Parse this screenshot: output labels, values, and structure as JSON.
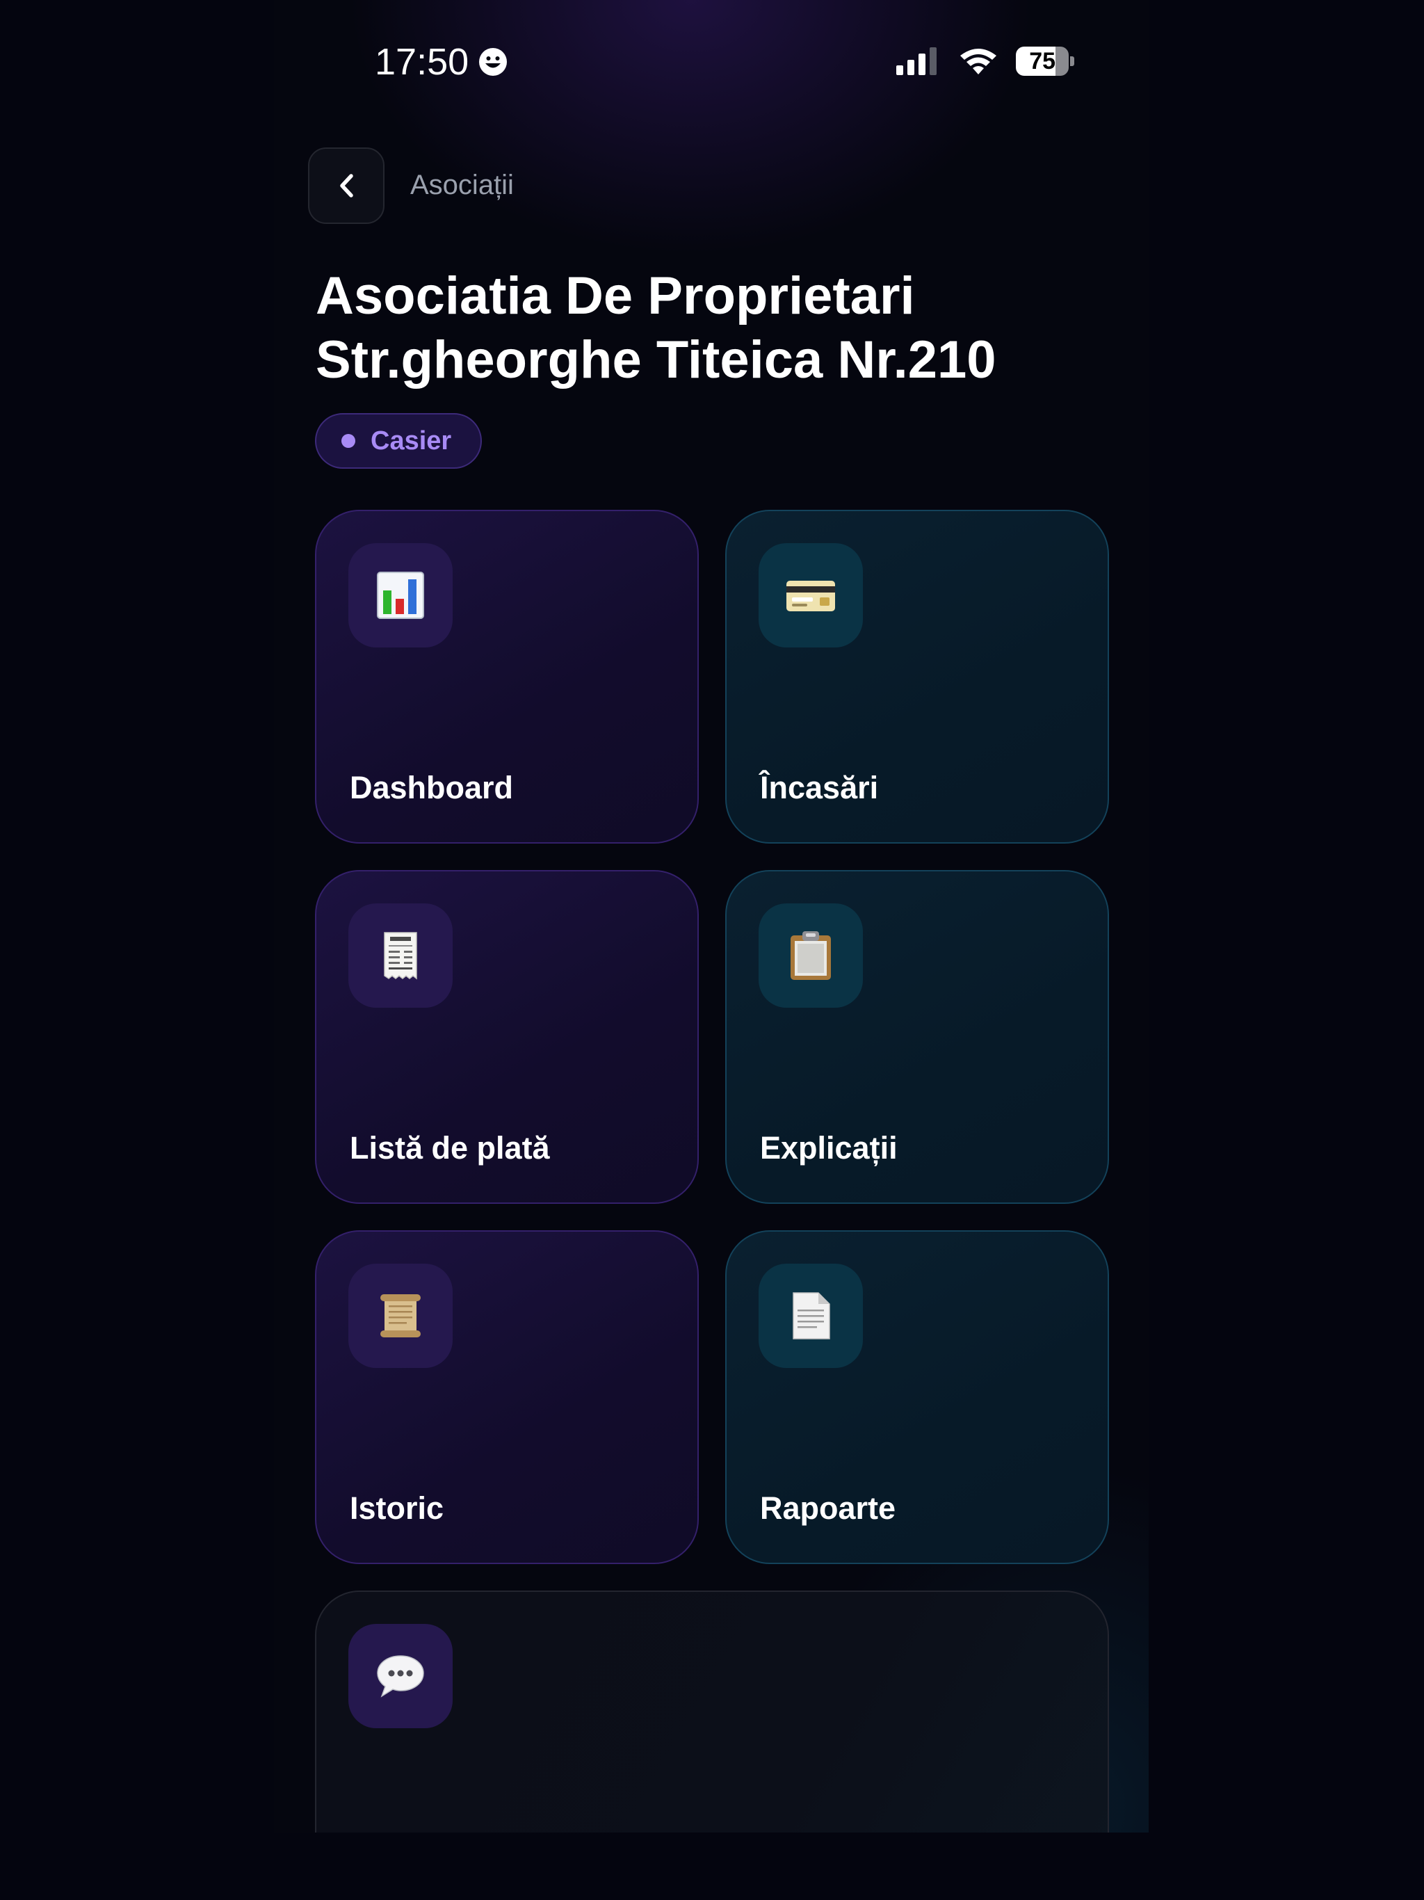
{
  "status_bar": {
    "time": "17:50",
    "battery": "75"
  },
  "header": {
    "back_icon": "chevron-left-icon",
    "breadcrumb": "Asociații",
    "title_line1": "Asociatia De Proprietari",
    "title_line2": "Str.gheorghe Titeica Nr.210",
    "role_badge": "Casier"
  },
  "colors": {
    "accent_purple": "#a88bf5",
    "card_purple": "#140d30",
    "card_teal": "#081c2a"
  },
  "tiles": [
    {
      "label": "Dashboard",
      "icon": "bar-chart-icon"
    },
    {
      "label": "Încasări",
      "icon": "credit-card-icon"
    },
    {
      "label": "Listă de plată",
      "icon": "receipt-icon"
    },
    {
      "label": "Explicații",
      "icon": "clipboard-icon"
    },
    {
      "label": "Istoric",
      "icon": "scroll-icon"
    },
    {
      "label": "Rapoarte",
      "icon": "document-icon"
    },
    {
      "label": "",
      "icon": "speech-bubble-icon"
    }
  ]
}
